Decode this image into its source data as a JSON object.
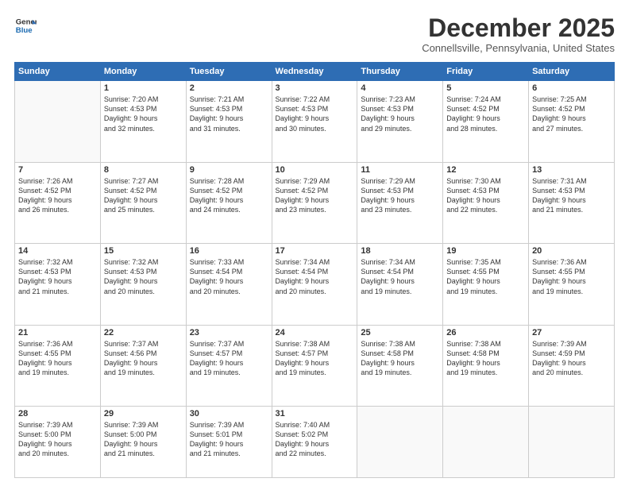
{
  "header": {
    "logo": {
      "line1": "General",
      "line2": "Blue"
    },
    "title": "December 2025",
    "location": "Connellsville, Pennsylvania, United States"
  },
  "days_of_week": [
    "Sunday",
    "Monday",
    "Tuesday",
    "Wednesday",
    "Thursday",
    "Friday",
    "Saturday"
  ],
  "weeks": [
    [
      {
        "day": "",
        "info": ""
      },
      {
        "day": "1",
        "info": "Sunrise: 7:20 AM\nSunset: 4:53 PM\nDaylight: 9 hours\nand 32 minutes."
      },
      {
        "day": "2",
        "info": "Sunrise: 7:21 AM\nSunset: 4:53 PM\nDaylight: 9 hours\nand 31 minutes."
      },
      {
        "day": "3",
        "info": "Sunrise: 7:22 AM\nSunset: 4:53 PM\nDaylight: 9 hours\nand 30 minutes."
      },
      {
        "day": "4",
        "info": "Sunrise: 7:23 AM\nSunset: 4:53 PM\nDaylight: 9 hours\nand 29 minutes."
      },
      {
        "day": "5",
        "info": "Sunrise: 7:24 AM\nSunset: 4:52 PM\nDaylight: 9 hours\nand 28 minutes."
      },
      {
        "day": "6",
        "info": "Sunrise: 7:25 AM\nSunset: 4:52 PM\nDaylight: 9 hours\nand 27 minutes."
      }
    ],
    [
      {
        "day": "7",
        "info": "Sunrise: 7:26 AM\nSunset: 4:52 PM\nDaylight: 9 hours\nand 26 minutes."
      },
      {
        "day": "8",
        "info": "Sunrise: 7:27 AM\nSunset: 4:52 PM\nDaylight: 9 hours\nand 25 minutes."
      },
      {
        "day": "9",
        "info": "Sunrise: 7:28 AM\nSunset: 4:52 PM\nDaylight: 9 hours\nand 24 minutes."
      },
      {
        "day": "10",
        "info": "Sunrise: 7:29 AM\nSunset: 4:52 PM\nDaylight: 9 hours\nand 23 minutes."
      },
      {
        "day": "11",
        "info": "Sunrise: 7:29 AM\nSunset: 4:53 PM\nDaylight: 9 hours\nand 23 minutes."
      },
      {
        "day": "12",
        "info": "Sunrise: 7:30 AM\nSunset: 4:53 PM\nDaylight: 9 hours\nand 22 minutes."
      },
      {
        "day": "13",
        "info": "Sunrise: 7:31 AM\nSunset: 4:53 PM\nDaylight: 9 hours\nand 21 minutes."
      }
    ],
    [
      {
        "day": "14",
        "info": "Sunrise: 7:32 AM\nSunset: 4:53 PM\nDaylight: 9 hours\nand 21 minutes."
      },
      {
        "day": "15",
        "info": "Sunrise: 7:32 AM\nSunset: 4:53 PM\nDaylight: 9 hours\nand 20 minutes."
      },
      {
        "day": "16",
        "info": "Sunrise: 7:33 AM\nSunset: 4:54 PM\nDaylight: 9 hours\nand 20 minutes."
      },
      {
        "day": "17",
        "info": "Sunrise: 7:34 AM\nSunset: 4:54 PM\nDaylight: 9 hours\nand 20 minutes."
      },
      {
        "day": "18",
        "info": "Sunrise: 7:34 AM\nSunset: 4:54 PM\nDaylight: 9 hours\nand 19 minutes."
      },
      {
        "day": "19",
        "info": "Sunrise: 7:35 AM\nSunset: 4:55 PM\nDaylight: 9 hours\nand 19 minutes."
      },
      {
        "day": "20",
        "info": "Sunrise: 7:36 AM\nSunset: 4:55 PM\nDaylight: 9 hours\nand 19 minutes."
      }
    ],
    [
      {
        "day": "21",
        "info": "Sunrise: 7:36 AM\nSunset: 4:55 PM\nDaylight: 9 hours\nand 19 minutes."
      },
      {
        "day": "22",
        "info": "Sunrise: 7:37 AM\nSunset: 4:56 PM\nDaylight: 9 hours\nand 19 minutes."
      },
      {
        "day": "23",
        "info": "Sunrise: 7:37 AM\nSunset: 4:57 PM\nDaylight: 9 hours\nand 19 minutes."
      },
      {
        "day": "24",
        "info": "Sunrise: 7:38 AM\nSunset: 4:57 PM\nDaylight: 9 hours\nand 19 minutes."
      },
      {
        "day": "25",
        "info": "Sunrise: 7:38 AM\nSunset: 4:58 PM\nDaylight: 9 hours\nand 19 minutes."
      },
      {
        "day": "26",
        "info": "Sunrise: 7:38 AM\nSunset: 4:58 PM\nDaylight: 9 hours\nand 19 minutes."
      },
      {
        "day": "27",
        "info": "Sunrise: 7:39 AM\nSunset: 4:59 PM\nDaylight: 9 hours\nand 20 minutes."
      }
    ],
    [
      {
        "day": "28",
        "info": "Sunrise: 7:39 AM\nSunset: 5:00 PM\nDaylight: 9 hours\nand 20 minutes."
      },
      {
        "day": "29",
        "info": "Sunrise: 7:39 AM\nSunset: 5:00 PM\nDaylight: 9 hours\nand 21 minutes."
      },
      {
        "day": "30",
        "info": "Sunrise: 7:39 AM\nSunset: 5:01 PM\nDaylight: 9 hours\nand 21 minutes."
      },
      {
        "day": "31",
        "info": "Sunrise: 7:40 AM\nSunset: 5:02 PM\nDaylight: 9 hours\nand 22 minutes."
      },
      {
        "day": "",
        "info": ""
      },
      {
        "day": "",
        "info": ""
      },
      {
        "day": "",
        "info": ""
      }
    ]
  ]
}
